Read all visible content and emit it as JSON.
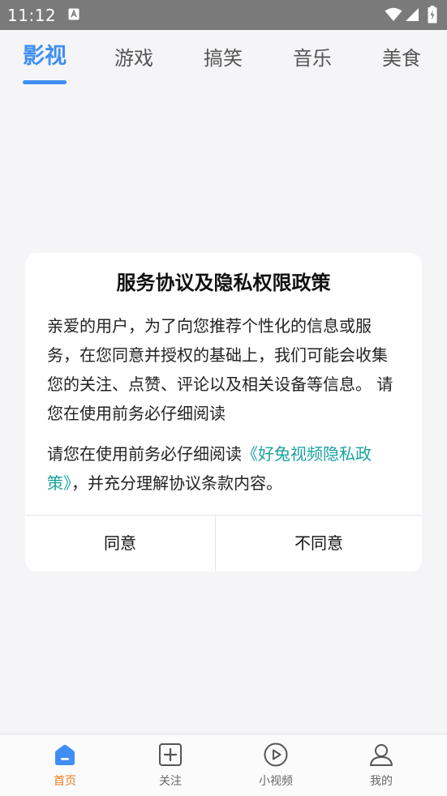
{
  "status_bar": {
    "time": "11:12",
    "icons": [
      "notification-a-icon",
      "wifi-icon",
      "signal-icon",
      "battery-charging-icon"
    ]
  },
  "tabs": [
    {
      "label": "影视",
      "active": true
    },
    {
      "label": "游戏",
      "active": false
    },
    {
      "label": "搞笑",
      "active": false
    },
    {
      "label": "音乐",
      "active": false
    },
    {
      "label": "美食",
      "active": false
    }
  ],
  "dialog": {
    "title": "服务协议及隐私权限政策",
    "paragraph1": "亲爱的用户，为了向您推荐个性化的信息或服务，在您同意并授权的基础上，我们可能会收集您的关注、点赞、评论以及相关设备等信息。 请您在使用前务必仔细阅读",
    "paragraph2_prefix": "请您在使用前务必仔细阅读",
    "policy_link": "《好兔视频隐私政策》",
    "paragraph2_suffix": "，并充分理解协议条款内容。",
    "agree_label": "同意",
    "disagree_label": "不同意"
  },
  "bottom_nav": [
    {
      "label": "首页",
      "icon": "home-icon",
      "active": true
    },
    {
      "label": "关注",
      "icon": "add-square-icon",
      "active": false
    },
    {
      "label": "小视频",
      "icon": "play-circle-icon",
      "active": false
    },
    {
      "label": "我的",
      "icon": "user-icon",
      "active": false
    }
  ],
  "colors": {
    "accent_blue": "#3f8ef5",
    "link_teal": "#1aa3a0",
    "nav_active_orange": "#f07b20",
    "status_bar": "#7a7a7a"
  }
}
